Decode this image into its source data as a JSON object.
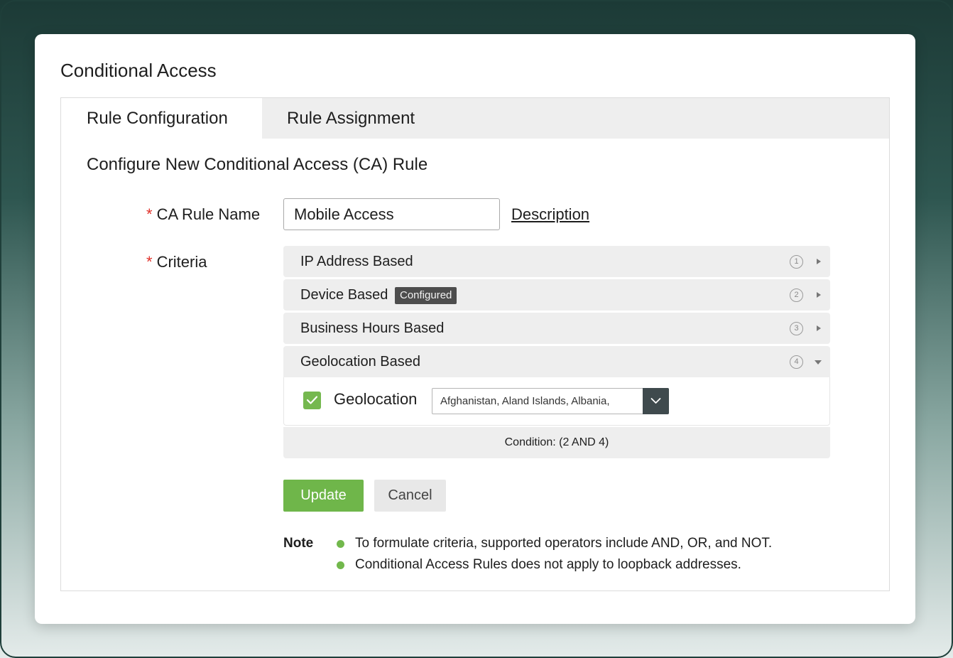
{
  "page": {
    "title": "Conditional Access"
  },
  "tabs": [
    {
      "label": "Rule Configuration",
      "active": true
    },
    {
      "label": "Rule Assignment",
      "active": false
    }
  ],
  "form": {
    "heading": "Configure New Conditional Access (CA) Rule",
    "required_marker": "*",
    "rule_name_label": "CA Rule Name",
    "rule_name_value": "Mobile Access",
    "description_link": "Description",
    "criteria_label": "Criteria"
  },
  "criteria": {
    "items": [
      {
        "label": "IP Address Based",
        "number": "1",
        "state": "collapsed"
      },
      {
        "label": "Device Based",
        "badge": "Configured",
        "number": "2",
        "state": "collapsed"
      },
      {
        "label": "Business Hours Based",
        "number": "3",
        "state": "collapsed"
      },
      {
        "label": "Geolocation Based",
        "number": "4",
        "state": "expanded"
      }
    ],
    "geolocation": {
      "checked": true,
      "label": "Geolocation",
      "selected": "Afghanistan, Aland Islands, Albania,"
    },
    "condition": "Condition: (2 AND 4)"
  },
  "actions": {
    "update_label": "Update",
    "cancel_label": "Cancel"
  },
  "notes": {
    "label": "Note",
    "items": [
      "To formulate criteria, supported operators include AND, OR, and NOT.",
      "Conditional Access Rules does not apply to loopback addresses."
    ]
  },
  "colors": {
    "accent_green": "#6fb64a",
    "required_red": "#e0312a",
    "badge_bg": "#4d4d4d"
  }
}
